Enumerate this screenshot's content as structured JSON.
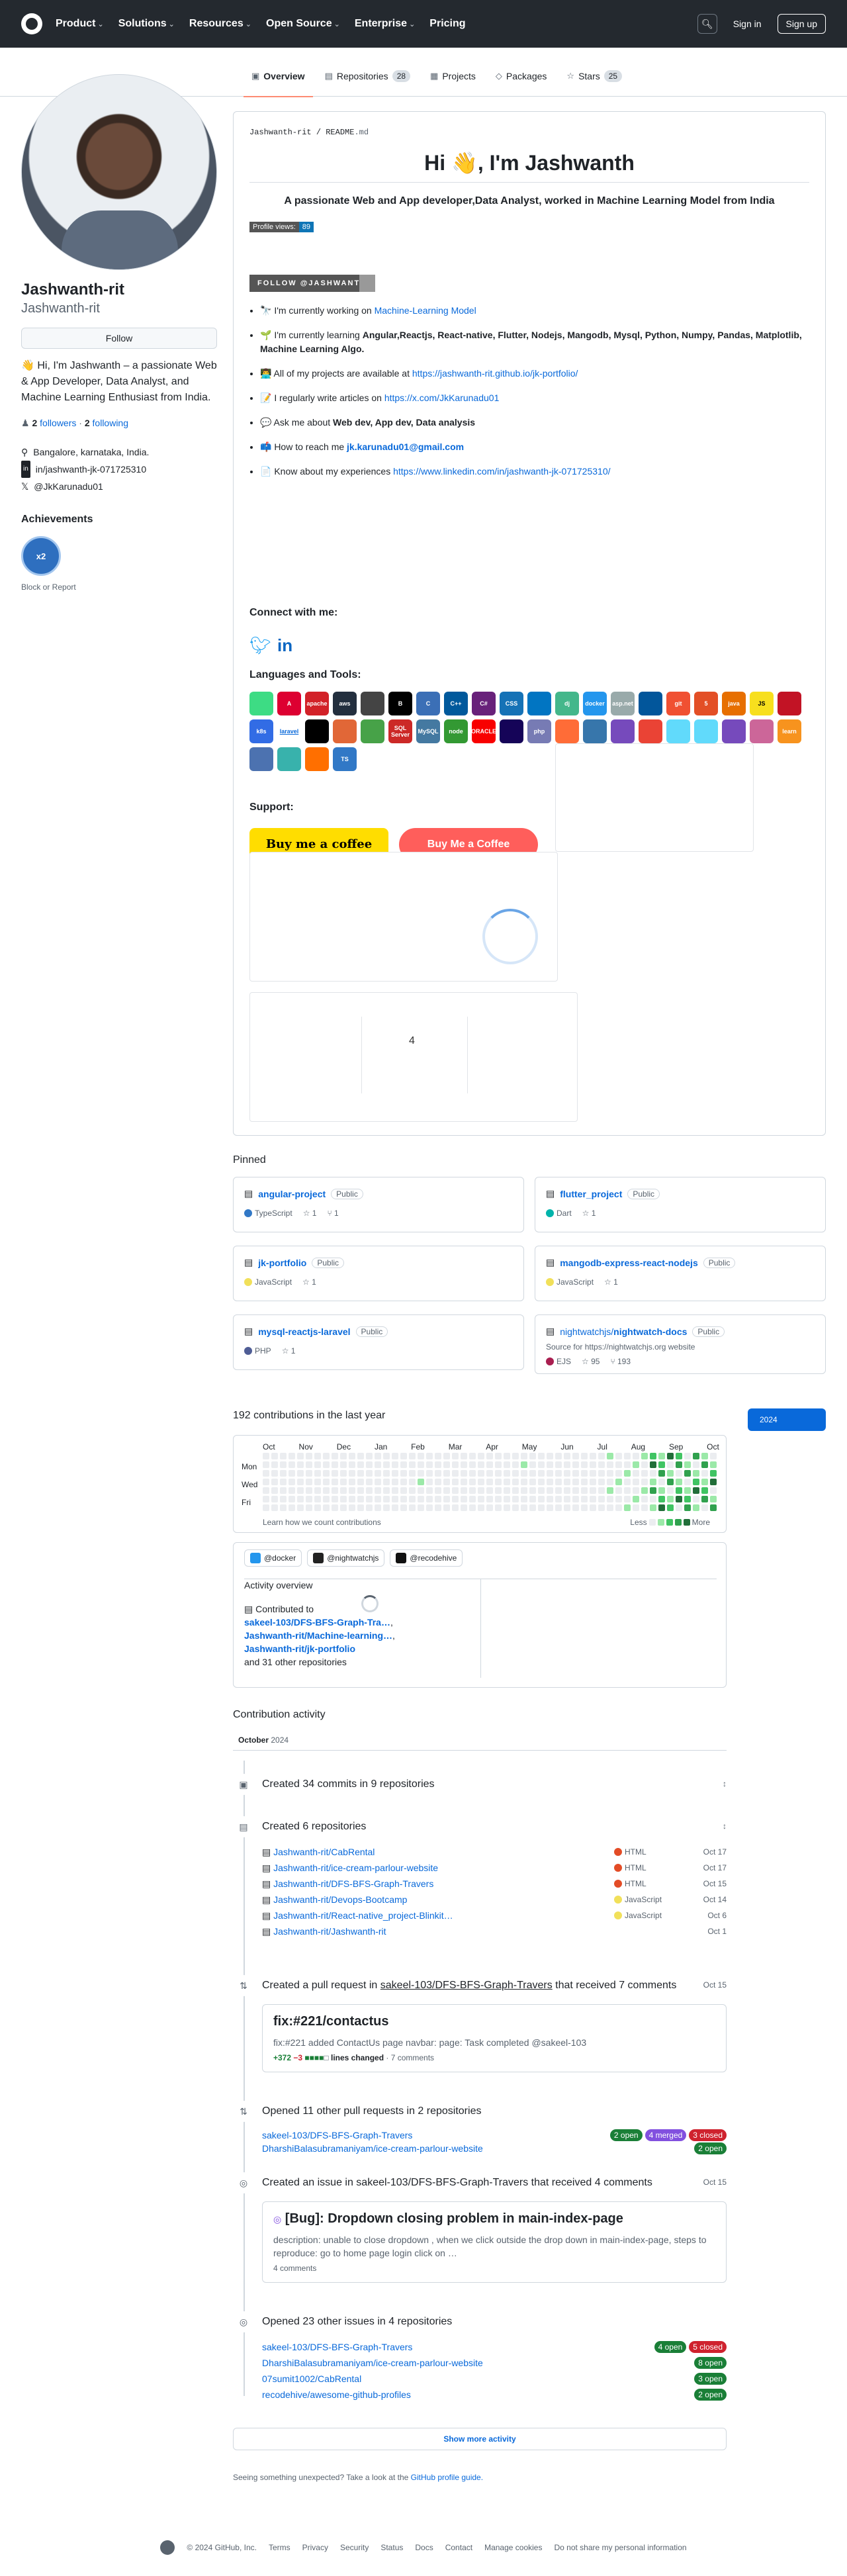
{
  "header": {
    "nav": [
      "Product",
      "Solutions",
      "Resources",
      "Open Source",
      "Enterprise",
      "Pricing"
    ],
    "signin": "Sign in",
    "signup": "Sign up"
  },
  "tabs": [
    {
      "label": "Overview",
      "count": ""
    },
    {
      "label": "Repositories",
      "count": "28"
    },
    {
      "label": "Projects",
      "count": ""
    },
    {
      "label": "Packages",
      "count": ""
    },
    {
      "label": "Stars",
      "count": "25"
    }
  ],
  "profile": {
    "name": "Jashwanth-rit",
    "username": "Jashwanth-rit",
    "follow": "Follow",
    "bio": "👋 Hi, I'm Jashwanth – a passionate Web & App Developer, Data Analyst, and Machine Learning Enthusiast from India.",
    "followers_count": "2",
    "followers_label": "followers",
    "following_count": "2",
    "following_label": "following",
    "location": "Bangalore, karnataka, India.",
    "linkedin": "in/jashwanth-jk-071725310",
    "twitter": "@JkKarunadu01",
    "achievements": "Achievements",
    "block": "Block or Report"
  },
  "readme": {
    "path_user": "Jashwanth-rit",
    "path_file": "README",
    "path_ext": ".md",
    "title": "Hi 👋, I'm Jashwanth",
    "subtitle": "A passionate Web and App developer,Data Analyst, worked in Machine Learning Model from India",
    "views_label": "Profile views:",
    "views_count": "89",
    "follow_badge": "FOLLOW @JASHWANTH",
    "items": {
      "i1": "🔭 I'm currently working on",
      "i1_link": "Machine-Learning Model",
      "i2": "🌱 I'm currently learning",
      "i2_b": "Angular,Reactjs, React-native, Flutter, Nodejs, Mangodb, Mysql, Python, Numpy, Pandas, Matplotlib, Machine Learning Algo.",
      "i3": "👨‍💻 All of my projects are available at",
      "i3_link": "https://jashwanth-rit.github.io/jk-portfolio/",
      "i4": "📝 I regularly write articles on",
      "i4_link": "https://x.com/JkKarunadu01",
      "i5": "💬 Ask me about",
      "i5_b": "Web dev, App dev, Data analysis",
      "i6": "📫 How to reach me",
      "i6_b": "jk.karunadu01@gmail.com",
      "i7": "📄 Know about my experiences",
      "i7_link": "https://www.linkedin.com/in/jashwanth-jk-071725310/"
    },
    "connect": "Connect with me:",
    "languages": "Languages and Tools:",
    "support": "Support:",
    "bmc1": "Buy me a coffee",
    "bmc2": "Buy Me a Coffee",
    "card3_value": "4",
    "tools": [
      {
        "name": "android",
        "label": "",
        "color": "#3ddc84"
      },
      {
        "name": "angular",
        "label": "A",
        "color": "#dd0031"
      },
      {
        "name": "apache",
        "label": "apache",
        "color": "#d22128"
      },
      {
        "name": "aws",
        "label": "aws",
        "color": "#232f3e"
      },
      {
        "name": "aws-cube",
        "label": "",
        "color": "#444"
      },
      {
        "name": "bootstrap-b",
        "label": "B",
        "color": "#000"
      },
      {
        "name": "c",
        "label": "C",
        "color": "#3b6fb6"
      },
      {
        "name": "cplusplus",
        "label": "C++",
        "color": "#00599c"
      },
      {
        "name": "csharp",
        "label": "C#",
        "color": "#68217a"
      },
      {
        "name": "css3",
        "label": "CSS",
        "color": "#1572b6"
      },
      {
        "name": "dart",
        "label": "",
        "color": "#0175c2"
      },
      {
        "name": "django",
        "label": "dj",
        "color": "#44b78b"
      },
      {
        "name": "docker",
        "label": "docker",
        "color": "#2496ed"
      },
      {
        "name": "dotnet",
        "label": "asp.net",
        "color": "#9aa"
      },
      {
        "name": "flutter",
        "label": "",
        "color": "#02569b"
      },
      {
        "name": "git",
        "label": "git",
        "color": "#f05032"
      },
      {
        "name": "html5",
        "label": "5",
        "color": "#e34f26"
      },
      {
        "name": "java",
        "label": "java",
        "color": "#e76f00"
      },
      {
        "name": "javascript",
        "label": "JS",
        "color": "#f7df1e"
      },
      {
        "name": "jest",
        "label": "",
        "color": "#c21325"
      },
      {
        "name": "kubernetes",
        "label": "k8s",
        "color": "#326ce5"
      },
      {
        "name": "laravel",
        "label": "laravel",
        "color": "#ffffff"
      },
      {
        "name": "linux",
        "label": "",
        "color": "#000"
      },
      {
        "name": "matlab",
        "label": "",
        "color": "#e16737"
      },
      {
        "name": "mongodb",
        "label": "",
        "color": "#47a248"
      },
      {
        "name": "mssql",
        "label": "SQL Server",
        "color": "#cc2927"
      },
      {
        "name": "mysql",
        "label": "MySQL",
        "color": "#4479a1"
      },
      {
        "name": "nodejs",
        "label": "node",
        "color": "#339933"
      },
      {
        "name": "oracle",
        "label": "ORACLE",
        "color": "#f80000"
      },
      {
        "name": "pandas",
        "label": "",
        "color": "#150458"
      },
      {
        "name": "php",
        "label": "php",
        "color": "#777bb4"
      },
      {
        "name": "postman",
        "label": "",
        "color": "#ff6c37"
      },
      {
        "name": "python",
        "label": "",
        "color": "#3776ab"
      },
      {
        "name": "redux",
        "label": "",
        "color": "#764abc"
      },
      {
        "name": "qt",
        "label": "",
        "color": "#ea4335"
      },
      {
        "name": "react",
        "label": "",
        "color": "#61dafb"
      },
      {
        "name": "reactnative",
        "label": "",
        "color": "#61dafb"
      },
      {
        "name": "redux2",
        "label": "",
        "color": "#764abc"
      },
      {
        "name": "sass",
        "label": "",
        "color": "#cc6699"
      },
      {
        "name": "scikit",
        "label": "learn",
        "color": "#f7931e"
      },
      {
        "name": "seaborn",
        "label": "",
        "color": "#4c72b0"
      },
      {
        "name": "tailwind",
        "label": "",
        "color": "#38b2ac"
      },
      {
        "name": "tensorflow",
        "label": "",
        "color": "#ff6f00"
      },
      {
        "name": "typescript",
        "label": "TS",
        "color": "#3178c6"
      }
    ]
  },
  "pinned": {
    "title": "Pinned",
    "items": [
      {
        "name": "angular-project",
        "owner": "",
        "vis": "Public",
        "desc": "",
        "lang": "TypeScript",
        "lang_color": "#3178c6",
        "stars": "1",
        "forks": "1"
      },
      {
        "name": "flutter_project",
        "owner": "",
        "vis": "Public",
        "desc": "",
        "lang": "Dart",
        "lang_color": "#00b4ab",
        "stars": "1",
        "forks": ""
      },
      {
        "name": "jk-portfolio",
        "owner": "",
        "vis": "Public",
        "desc": "",
        "lang": "JavaScript",
        "lang_color": "#f1e05a",
        "stars": "1",
        "forks": ""
      },
      {
        "name": "mangodb-express-react-nodejs",
        "owner": "",
        "vis": "Public",
        "desc": "",
        "lang": "JavaScript",
        "lang_color": "#f1e05a",
        "stars": "1",
        "forks": ""
      },
      {
        "name": "mysql-reactjs-laravel",
        "owner": "",
        "vis": "Public",
        "desc": "",
        "lang": "PHP",
        "lang_color": "#4f5d95",
        "stars": "1",
        "forks": ""
      },
      {
        "name": "nightwatch-docs",
        "owner": "nightwatchjs/",
        "vis": "Public",
        "desc": "Source for https://nightwatchjs.org website",
        "lang": "EJS",
        "lang_color": "#a91e50",
        "stars": "95",
        "forks": "193"
      }
    ]
  },
  "contrib": {
    "title": "192 contributions in the last year",
    "year": "2024",
    "months": [
      "Oct",
      "Nov",
      "Dec",
      "Jan",
      "Feb",
      "Mar",
      "Apr",
      "May",
      "Jun",
      "Jul",
      "Aug",
      "Sep",
      "Oct"
    ],
    "days": [
      "Mon",
      "Wed",
      "Fri"
    ],
    "learn": "Learn how we count contributions",
    "less": "Less",
    "more": "More",
    "colors": [
      "#ebedf0",
      "#9be9a8",
      "#40c463",
      "#30a14e",
      "#216e39"
    ]
  },
  "activity": {
    "orgs": [
      {
        "name": "@docker",
        "color": "#2496ed"
      },
      {
        "name": "@nightwatchjs",
        "color": "#222"
      },
      {
        "name": "@recodehive",
        "color": "#111"
      }
    ],
    "overview": "Activity overview",
    "contributed_to": "Contributed to",
    "repo1": "sakeel-103/DFS-BFS-Graph-Tra…",
    "repo2": "Jashwanth-rit/Machine-learning…",
    "repo3": "Jashwanth-rit/jk-portfolio",
    "others": "and 31 other repositories"
  },
  "timeline": {
    "title": "Contribution activity",
    "month": "October",
    "month_year": "2024",
    "commits": "Created 34 commits in 9 repositories",
    "repos_title": "Created 6 repositories",
    "repos": [
      {
        "name": "Jashwanth-rit/CabRental",
        "lang": "HTML",
        "color": "#e34c26",
        "date": "Oct 17"
      },
      {
        "name": "Jashwanth-rit/ice-cream-parlour-website",
        "lang": "HTML",
        "color": "#e34c26",
        "date": "Oct 17"
      },
      {
        "name": "Jashwanth-rit/DFS-BFS-Graph-Travers",
        "lang": "HTML",
        "color": "#e34c26",
        "date": "Oct 15"
      },
      {
        "name": "Jashwanth-rit/Devops-Bootcamp",
        "lang": "JavaScript",
        "color": "#f1e05a",
        "date": "Oct 14"
      },
      {
        "name": "Jashwanth-rit/React-native_project-Blinkit…",
        "lang": "JavaScript",
        "color": "#f1e05a",
        "date": "Oct 6"
      },
      {
        "name": "Jashwanth-rit/Jashwanth-rit",
        "lang": "",
        "color": "",
        "date": "Oct 1"
      }
    ],
    "pr_pre": "Created a pull request in",
    "pr_repo": "sakeel-103/DFS-BFS-Graph-Travers",
    "pr_post": "that received 7 comments",
    "pr_date": "Oct 15",
    "pr_title": "fix:#221/contactus",
    "pr_body": "fix:#221 added ContactUs page navbar: page: Task completed @sakeel-103",
    "pr_add": "+372",
    "pr_del": "−3",
    "pr_lines": "lines changed",
    "pr_comments": "7 comments",
    "opened_prs": "Opened 11 other pull requests in 2 repositories",
    "pr_rows": [
      {
        "name": "sakeel-103/DFS-BFS-Graph-Travers",
        "open": "2 open",
        "merged": "4 merged",
        "closed": "3 closed"
      },
      {
        "name": "DharshiBalasubramaniyam/ice-cream-parlour-website",
        "open": "2 open",
        "merged": "",
        "closed": ""
      }
    ],
    "issue_pre": "Created an issue in sakeel-103/DFS-BFS-Graph-Travers that received 4 comments",
    "issue_date": "Oct 15",
    "issue_title": "[Bug]: Dropdown closing problem in main-index-page",
    "issue_body": "description: unable to close dropdown , when we click outside the drop down in main-index-page, steps to reproduce: go to home page login click on …",
    "issue_comments": "4 comments",
    "opened_issues": "Opened 23 other issues in 4 repositories",
    "issue_rows": [
      {
        "name": "sakeel-103/DFS-BFS-Graph-Travers",
        "open": "4 open",
        "closed": "5 closed"
      },
      {
        "name": "DharshiBalasubramaniyam/ice-cream-parlour-website",
        "open": "8 open",
        "closed": ""
      },
      {
        "name": "07sumit1002/CabRental",
        "open": "3 open",
        "closed": ""
      },
      {
        "name": "recodehive/awesome-github-profiles",
        "open": "2 open",
        "closed": ""
      }
    ],
    "show_more": "Show more activity",
    "seeing": "Seeing something unexpected? Take a look at the",
    "guide": "GitHub profile guide."
  },
  "footer": {
    "copy": "© 2024 GitHub, Inc.",
    "links": [
      "Terms",
      "Privacy",
      "Security",
      "Status",
      "Docs",
      "Contact",
      "Manage cookies",
      "Do not share my personal information"
    ]
  }
}
